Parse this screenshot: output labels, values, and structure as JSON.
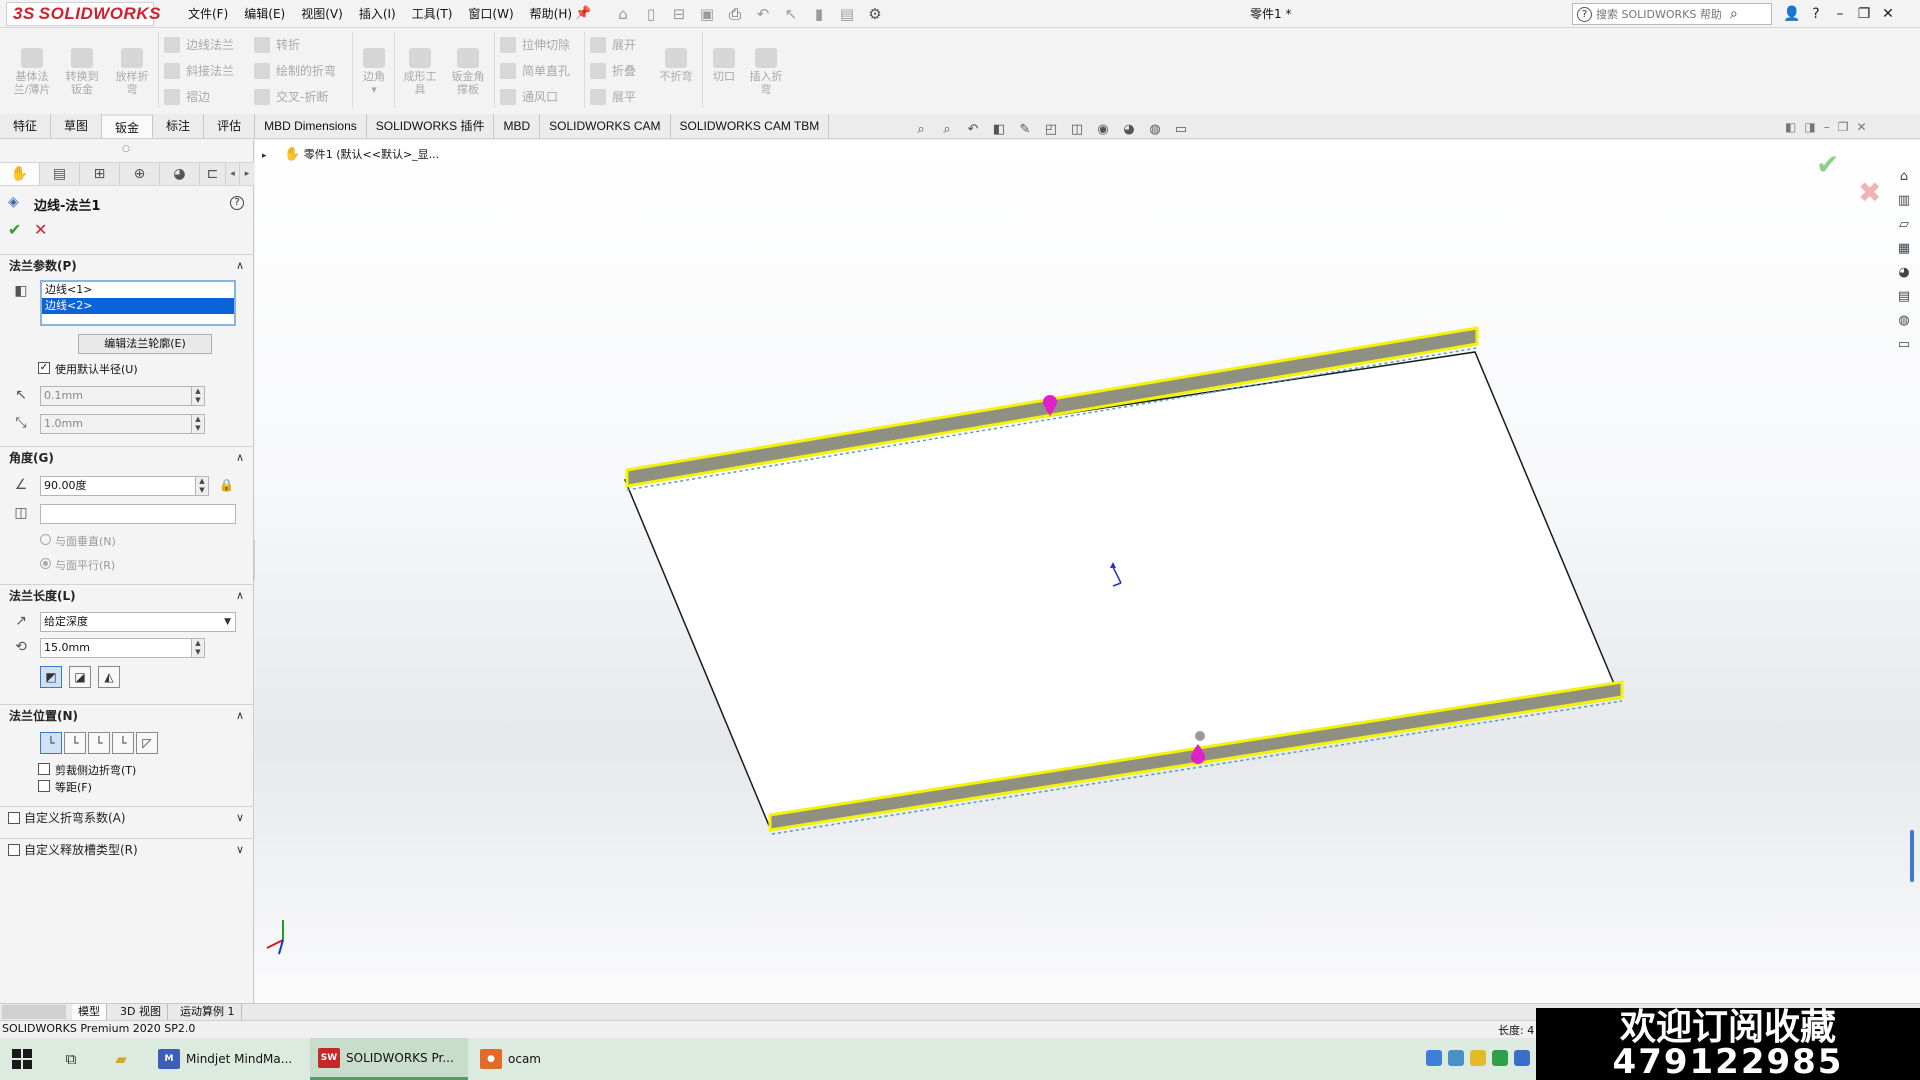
{
  "app": {
    "logo": "SOLIDWORKS",
    "logo_ds": "3S",
    "document_title": "零件1 *",
    "search_placeholder": "搜索 SOLIDWORKS 帮助",
    "search_help": "?"
  },
  "menu": [
    "文件(F)",
    "编辑(E)",
    "视图(V)",
    "插入(I)",
    "工具(T)",
    "窗口(W)",
    "帮助(H)"
  ],
  "window_controls": {
    "help": "?",
    "minimize": "–",
    "restore": "❐",
    "close": "✕"
  },
  "ribbon": {
    "large": [
      {
        "label1": "基体法",
        "label2": "兰/薄片"
      },
      {
        "label1": "转换到",
        "label2": "钣金"
      },
      {
        "label1": "放样折",
        "label2": "弯"
      }
    ],
    "col1": [
      "边线法兰",
      "斜接法兰",
      "褶边"
    ],
    "col2": [
      "转折",
      "绘制的折弯",
      "交叉-折断"
    ],
    "corner": "边角",
    "tools_large": [
      {
        "label1": "成形工",
        "label2": "具"
      },
      {
        "label1": "钣金角",
        "label2": "撑板"
      }
    ],
    "col3": [
      "拉伸切除",
      "简单直孔",
      "通风口"
    ],
    "col4": [
      "展开",
      "折叠",
      "展平"
    ],
    "unfold_large": [
      {
        "label1": "不折弯",
        "label2": ""
      },
      {
        "label1": "切口",
        "label2": ""
      },
      {
        "label1": "插入折",
        "label2": "弯"
      }
    ]
  },
  "command_tabs": [
    "特征",
    "草图",
    "钣金",
    "标注",
    "评估",
    "MBD Dimensions",
    "SOLIDWORKS 插件",
    "MBD",
    "SOLIDWORKS CAM",
    "SOLIDWORKS CAM TBM"
  ],
  "active_tab": "钣金",
  "property_manager": {
    "title": "边线-法兰1",
    "help": "?",
    "ok": "✔",
    "cancel": "✕",
    "flange_params": {
      "header": "法兰参数(P)",
      "edges": [
        "边线<1>",
        "边线<2>"
      ],
      "edit_profile_button": "编辑法兰轮廓(E)",
      "use_default_radius": "使用默认半径(U)",
      "radius_value": "0.1mm",
      "gap_value": "1.0mm"
    },
    "angle": {
      "header": "角度(G)",
      "value": "90.00度",
      "ref_value": "",
      "perpendicular": "与面垂直(N)",
      "parallel": "与面平行(R)"
    },
    "flange_length": {
      "header": "法兰长度(L)",
      "end_condition": "给定深度",
      "value": "15.0mm"
    },
    "flange_position": {
      "header": "法兰位置(N)",
      "trim_side_bends": "剪裁侧边折弯(T)",
      "offset": "等距(F)"
    },
    "custom_bend_allowance": "自定义折弯系数(A)",
    "custom_relief_type": "自定义释放槽类型(R)"
  },
  "viewport": {
    "tree_root": "零件1 (默认<<默认>_显..."
  },
  "bottom_tabs": [
    "模型",
    "3D 视图",
    "运动算例 1"
  ],
  "status": {
    "version": "SOLIDWORKS Premium 2020 SP2.0",
    "length": "长度: 4"
  },
  "taskbar": {
    "tasks": [
      {
        "label": "Mindjet MindMa...",
        "icon": "M",
        "color": "#3b5fb5"
      },
      {
        "label": "SOLIDWORKS Pr...",
        "icon": "SW",
        "color": "#c5282a"
      },
      {
        "label": "ocam",
        "icon": "●",
        "color": "#e26b2a"
      }
    ]
  },
  "overlay": {
    "line1": "欢迎订阅收藏",
    "line2": "479122985"
  },
  "colors": {
    "flange_yellow": "#f2f20a",
    "flange_gray": "#8f8f82",
    "handle_magenta": "#e020c8",
    "selection_blue": "#0a64d8"
  }
}
